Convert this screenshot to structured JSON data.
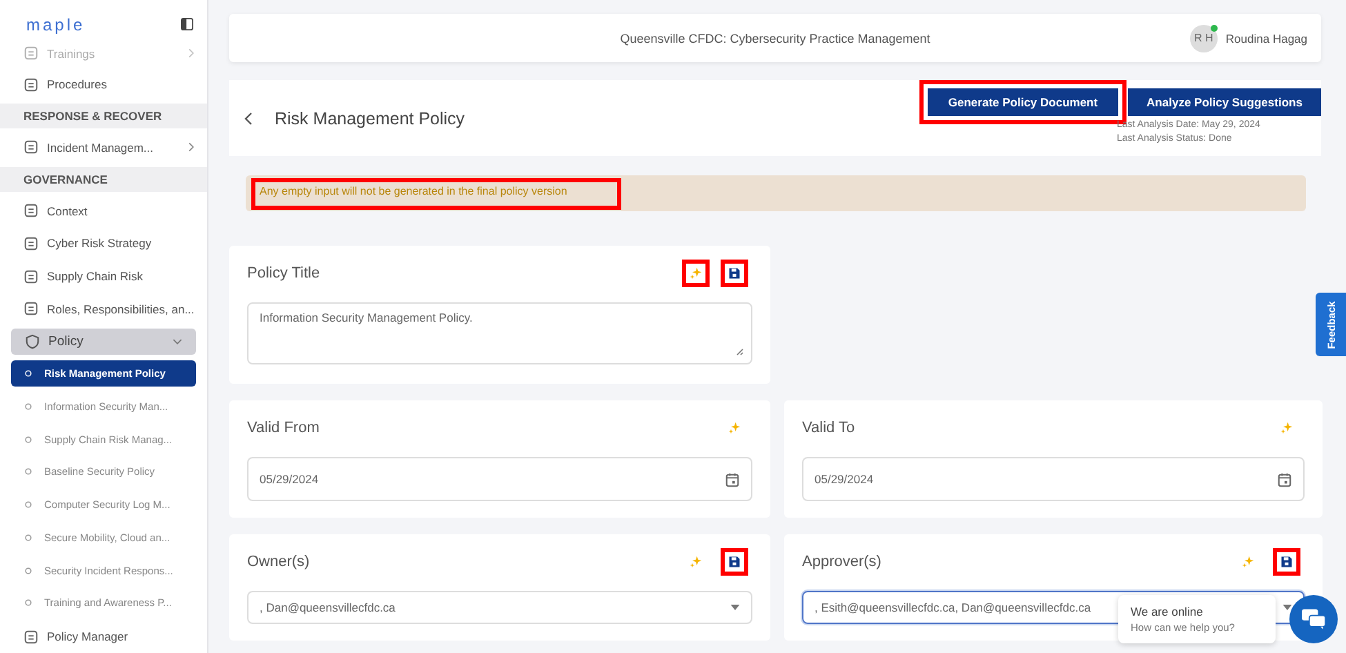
{
  "sidebar": {
    "logo": "maple",
    "items": [
      {
        "kind": "link",
        "label": "Trainings",
        "faded": true,
        "chevron": true
      },
      {
        "kind": "link",
        "label": "Procedures",
        "faded": false,
        "chevron": false
      },
      {
        "kind": "header",
        "label": "RESPONSE & RECOVER"
      },
      {
        "kind": "link",
        "label": "Incident Managem...",
        "faded": false,
        "chevron": true
      },
      {
        "kind": "header",
        "label": "GOVERNANCE"
      },
      {
        "kind": "link",
        "label": "Context",
        "faded": false,
        "chevron": false
      },
      {
        "kind": "link",
        "label": "Cyber Risk Strategy",
        "faded": false,
        "chevron": false
      },
      {
        "kind": "link",
        "label": "Supply Chain Risk",
        "faded": false,
        "chevron": false
      },
      {
        "kind": "link",
        "label": "Roles, Responsibilities, an...",
        "faded": false,
        "chevron": false
      },
      {
        "kind": "group",
        "label": "Policy",
        "expanded": true,
        "children": [
          {
            "label": "Risk Management Policy",
            "selected": true
          },
          {
            "label": "Information Security Man...",
            "selected": false
          },
          {
            "label": "Supply Chain Risk Manag...",
            "selected": false
          },
          {
            "label": "Baseline Security Policy",
            "selected": false
          },
          {
            "label": "Computer Security Log M...",
            "selected": false
          },
          {
            "label": "Secure Mobility, Cloud an...",
            "selected": false
          },
          {
            "label": "Security Incident Respons...",
            "selected": false
          },
          {
            "label": "Training and Awareness P...",
            "selected": false
          }
        ]
      },
      {
        "kind": "link",
        "label": "Policy Manager",
        "faded": false,
        "chevron": false
      }
    ]
  },
  "header": {
    "title": "Queensville CFDC: Cybersecurity Practice Management",
    "user": {
      "initials": "R H",
      "name": "Roudina Hagag",
      "online": true
    }
  },
  "page": {
    "title": "Risk Management Policy",
    "buttons": [
      {
        "label": "Generate Policy Document",
        "highlighted": true
      },
      {
        "label": "Analyze Policy Suggestions",
        "highlighted": false
      }
    ],
    "analysis": [
      "Last Analysis Date: May 29, 2024",
      "Last Analysis Status: Done"
    ]
  },
  "alert": {
    "text": "Any empty input will not be generated in the final policy version",
    "highlighted": true
  },
  "title_field": {
    "label": "Policy Title",
    "value": "Information Security Management Policy.",
    "sparkle_highlighted": true,
    "save_highlighted": true
  },
  "fields": [
    {
      "label": "Valid From",
      "kind": "date",
      "value": "05/29/2024",
      "sparkle_highlighted": false
    },
    {
      "label": "Valid To",
      "kind": "date",
      "value": "05/29/2024",
      "sparkle_highlighted": false
    },
    {
      "label": "Owner(s)",
      "kind": "select",
      "value": ", Dan@queensvillecfdc.ca",
      "sparkle_highlighted": false,
      "save_highlighted": true,
      "focused": false
    },
    {
      "label": "Approver(s)",
      "kind": "select",
      "value": ", Esith@queensvillecfdc.ca, Dan@queensvillecfdc.ca",
      "sparkle_highlighted": false,
      "save_highlighted": true,
      "focused": true
    }
  ],
  "feedback": "Feedback",
  "chat": {
    "title": "We are online",
    "subtitle": "How can we help you?"
  }
}
